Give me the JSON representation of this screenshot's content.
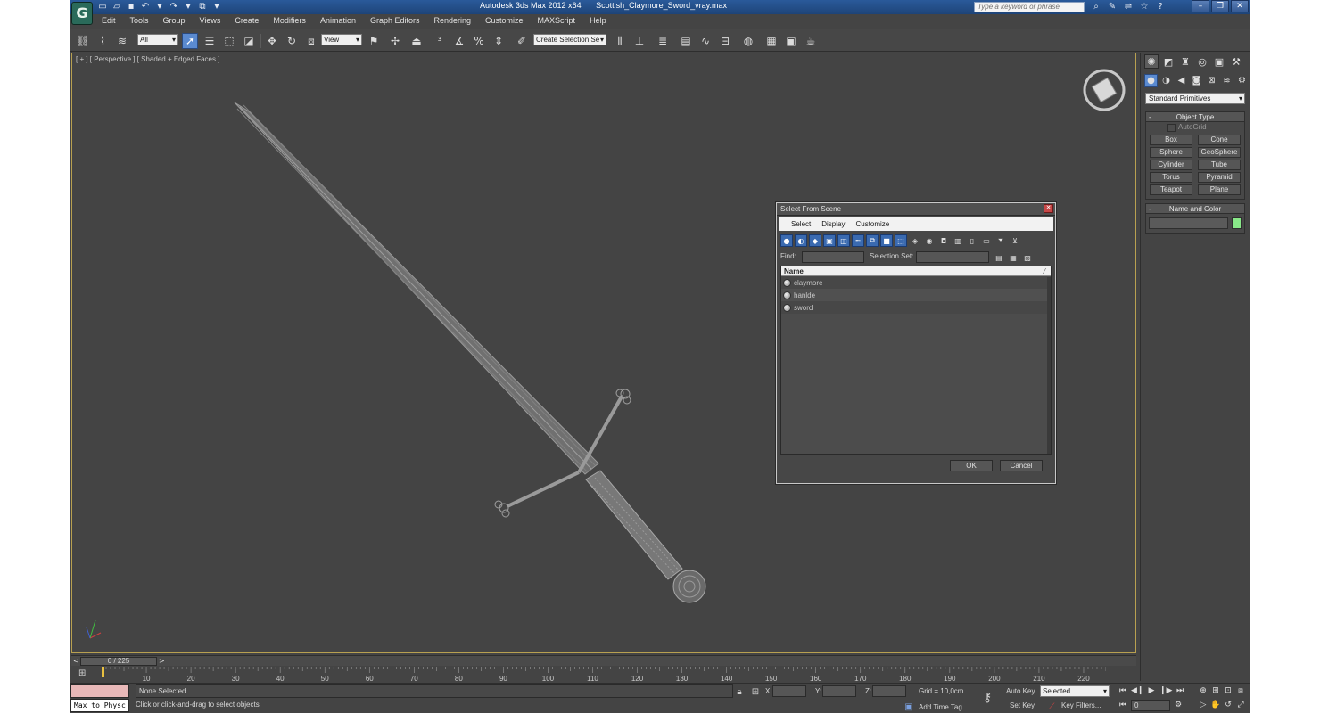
{
  "window": {
    "app_name": "Autodesk 3ds Max  2012 x64",
    "file_name": "Scottish_Claymore_Sword_vray.max",
    "help_search_placeholder": "Type a keyword or phrase"
  },
  "menubar": [
    "Edit",
    "Tools",
    "Group",
    "Views",
    "Create",
    "Modifiers",
    "Animation",
    "Graph Editors",
    "Rendering",
    "Customize",
    "MAXScript",
    "Help"
  ],
  "toolbar": {
    "selection_filter": "All",
    "reference_coord": "View",
    "named_selection_set": "Create Selection Se"
  },
  "viewport": {
    "label": "[ + ] [ Perspective ] [ Shaded + Edged Faces ]"
  },
  "command_panel": {
    "category": "Standard Primitives",
    "object_type_title": "Object Type",
    "autogrid_label": "AutoGrid",
    "object_buttons": [
      "Box",
      "Cone",
      "Sphere",
      "GeoSphere",
      "Cylinder",
      "Tube",
      "Torus",
      "Pyramid",
      "Teapot",
      "Plane"
    ],
    "name_color_title": "Name and Color",
    "object_color": "#88e888"
  },
  "dialog": {
    "title": "Select From Scene",
    "menu": [
      "Select",
      "Display",
      "Customize"
    ],
    "find_label": "Find:",
    "selection_set_label": "Selection Set:",
    "column_header": "Name",
    "objects": [
      "claymore",
      "hanlde",
      "sword"
    ],
    "ok_label": "OK",
    "cancel_label": "Cancel"
  },
  "timeline": {
    "frame_readout": "0 / 225",
    "ruler_ticks": [
      "10",
      "20",
      "30",
      "40",
      "50",
      "60",
      "70",
      "80",
      "90",
      "100",
      "110",
      "120",
      "130",
      "140",
      "150",
      "160",
      "170",
      "180",
      "190",
      "200",
      "210",
      "220"
    ]
  },
  "statusbar": {
    "maxscript_mini": "Max to Physc",
    "selection_status": "None Selected",
    "prompt": "Click or click-and-drag to select objects",
    "x_label": "X:",
    "y_label": "Y:",
    "z_label": "Z:",
    "grid": "Grid = 10,0cm",
    "add_time_tag": "Add Time Tag",
    "auto_key": "Auto Key",
    "set_key": "Set Key",
    "key_mode": "Selected",
    "key_filters": "Key Filters...",
    "current_frame": "0"
  }
}
